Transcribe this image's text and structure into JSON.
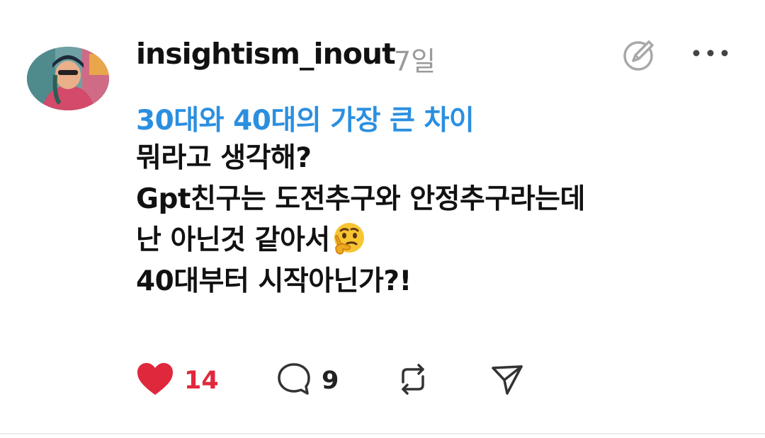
{
  "post": {
    "username": "insightism_inout",
    "timestamp": "7일",
    "topic": "30대와 40대의 가장 큰 차이",
    "lines": [
      "뭐라고 생각해?",
      "Gpt친구는 도전추구와 안정추구라는데",
      "난 아닌것 같아서",
      "40대부터 시작아닌가?!"
    ],
    "emoji": "thinking-face"
  },
  "actions": {
    "likes": "14",
    "comments": "9"
  },
  "colors": {
    "topic": "#2b8fe0",
    "like": "#e0283c",
    "timestamp": "#9a9a9a"
  },
  "icons": [
    "heart-icon",
    "comment-icon",
    "repost-icon",
    "share-icon",
    "edit-icon",
    "more-icon"
  ]
}
